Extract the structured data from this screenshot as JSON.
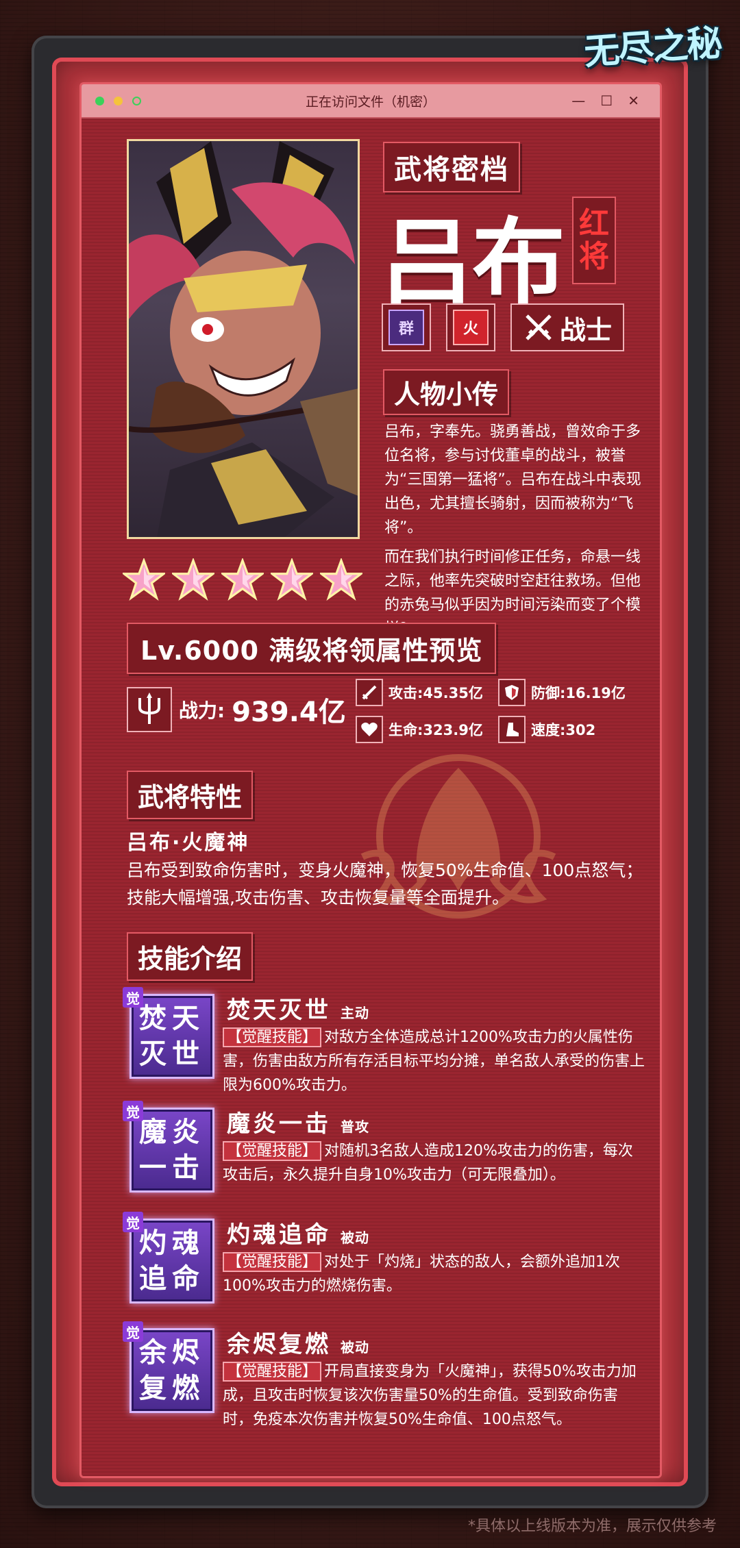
{
  "logo": "无尽之秘",
  "window": {
    "title": "正在访问文件（机密）",
    "controls": [
      "—",
      "☐",
      "✕"
    ]
  },
  "dossier_label": "武将密档",
  "hero": {
    "name": "吕布",
    "rarity": [
      "红",
      "将"
    ],
    "faction": "群",
    "element": "火",
    "role": "战士",
    "stars": 5
  },
  "bio": {
    "title": "人物小传",
    "p1": "吕布，字奉先。骁勇善战，曾效命于多位名将，参与讨伐董卓的战斗，被誉为“三国第一猛将”。吕布在战斗中表现出色，尤其擅长骑射，因而被称为“飞将”。",
    "p2": "而在我们执行时间修正任务，命悬一线之际，他率先突破时空赶往救场。但他的赤兔马似乎因为时间污染而变了个模样？"
  },
  "level": {
    "title": "Lv.6000 满级将领属性预览",
    "power_label": "战力:",
    "power_value": "939.4亿",
    "attack": "攻击:45.35亿",
    "defense": "防御:16.19亿",
    "hp": "生命:323.9亿",
    "speed": "速度:302"
  },
  "trait": {
    "title": "武将特性",
    "name": "吕布·火魔神",
    "desc": "吕布受到致命伤害时，变身火魔神，恢复50%生命值、100点怒气；技能大幅增强,攻击伤害、攻击恢复量等全面提升。"
  },
  "skills_title": "技能介绍",
  "skills": [
    {
      "badge": "觉",
      "icon_line1": "焚天",
      "icon_line2": "灭世",
      "name": "焚天灭世",
      "type": "主动",
      "tag": "【觉醒技能】",
      "desc": "对敌方全体造成总计1200%攻击力的火属性伤害，伤害由敌方所有存活目标平均分摊，单名敌人承受的伤害上限为600%攻击力。"
    },
    {
      "badge": "觉",
      "icon_line1": "魔炎",
      "icon_line2": "一击",
      "name": "魔炎一击",
      "type": "普攻",
      "tag": "【觉醒技能】",
      "desc": "对随机3名敌人造成120%攻击力的伤害，每次攻击后，永久提升自身10%攻击力（可无限叠加）。"
    },
    {
      "badge": "觉",
      "icon_line1": "灼魂",
      "icon_line2": "追命",
      "name": "灼魂追命",
      "type": "被动",
      "tag": "【觉醒技能】",
      "desc": "对处于「灼烧」状态的敌人，会额外追加1次100%攻击力的燃烧伤害。"
    },
    {
      "badge": "觉",
      "icon_line1": "余烬",
      "icon_line2": "复燃",
      "name": "余烬复燃",
      "type": "被动",
      "tag": "【觉醒技能】",
      "desc": "开局直接变身为「火魔神」，获得50%攻击力加成，且攻击时恢复该次伤害量50%的生命值。受到致命伤害时，免疫本次伤害并恢复50%生命值、100点怒气。"
    }
  ],
  "footnote": "*具体以上线版本为准，展示仅供参考"
}
